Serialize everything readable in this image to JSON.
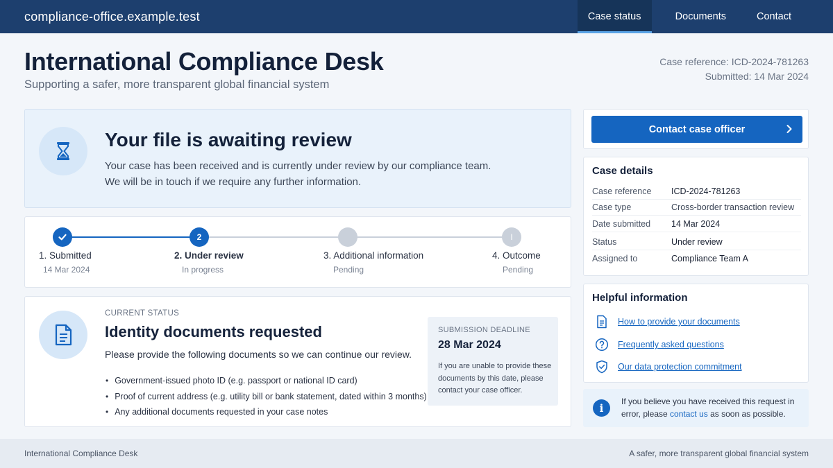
{
  "topbar": {
    "domain": "compliance-office.example.test",
    "nav": [
      {
        "label": "Case status",
        "active": true
      },
      {
        "label": "Documents",
        "active": false
      },
      {
        "label": "Contact",
        "active": false
      }
    ]
  },
  "header": {
    "title": "International Compliance Desk",
    "subtitle": "Supporting a safer, more transparent global financial system",
    "case_reference": "Case reference: ICD-2024-781263",
    "submitted": "Submitted: 14 Mar 2024"
  },
  "await": {
    "icon": "hourglass-icon",
    "title": "Your file is awaiting review",
    "line1": "Your case has been received and is currently under review by our compliance team.",
    "line2": "We will be in touch if we require any further information."
  },
  "progress": {
    "steps": [
      {
        "label": "1.  Submitted",
        "sub": "14 Mar 2024",
        "state": "done",
        "marker": "✓"
      },
      {
        "label": "2.  Under review",
        "sub": "In progress",
        "state": "current",
        "marker": "2"
      },
      {
        "label": "3.  Additional information",
        "sub": "Pending",
        "state": "pending",
        "marker": ""
      },
      {
        "label": "4.  Outcome",
        "sub": "Pending",
        "state": "pending",
        "marker": "I"
      }
    ],
    "colors": {
      "done": "#1565c0",
      "pending": "#c9d0da"
    }
  },
  "status": {
    "icon": "document-icon",
    "eyebrow": "CURRENT STATUS",
    "title": "Identity documents requested",
    "description": "Please provide the following documents so we can continue our review.",
    "items": [
      "Government-issued photo ID (e.g. passport or national ID card)",
      "Proof of current address (e.g. utility bill or bank statement, dated within 3 months)",
      "Any additional documents requested in your case notes"
    ],
    "deadline": {
      "eyebrow": "SUBMISSION DEADLINE",
      "date": "28 Mar 2024",
      "text": "If you are unable to provide these documents by this date, please contact your case officer."
    }
  },
  "sidebar": {
    "contact_button": "Contact case officer",
    "details": {
      "title": "Case details",
      "rows": [
        {
          "key": "Case reference",
          "value": "ICD-2024-781263"
        },
        {
          "key": "Case type",
          "value": "Cross-border transaction review"
        },
        {
          "key": "Date submitted",
          "value": "14 Mar 2024"
        },
        {
          "key": "Status",
          "value": "Under review"
        },
        {
          "key": "Assigned to",
          "value": "Compliance Team A"
        }
      ]
    },
    "help": {
      "title": "Helpful information",
      "links": [
        {
          "icon": "document-icon",
          "label": "How to provide your documents"
        },
        {
          "icon": "question-icon",
          "label": "Frequently asked questions"
        },
        {
          "icon": "shield-check-icon",
          "label": "Our data protection commitment"
        }
      ]
    },
    "notice": {
      "icon": "info-icon",
      "text_before": "If you believe you have received this request in error, please ",
      "link": "contact us",
      "text_after": " as soon as possible."
    }
  },
  "footer": {
    "left": "International Compliance Desk",
    "right": "A safer, more transparent global financial system"
  },
  "colors": {
    "brand_dark": "#1d3f6e",
    "accent": "#1565c0",
    "panel_tint": "#e9f2fb"
  }
}
